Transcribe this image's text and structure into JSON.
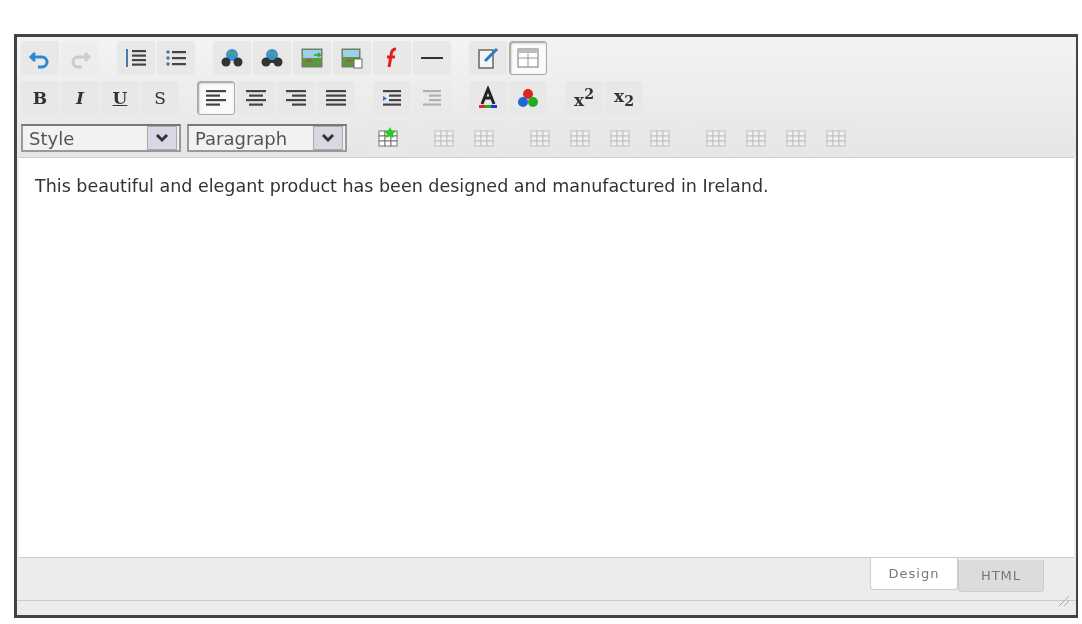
{
  "toolbar_rows": [
    [
      {
        "kind": "undo",
        "disabled": false,
        "active": false
      },
      {
        "kind": "redo",
        "disabled": true,
        "active": false
      },
      {
        "kind": "sep"
      },
      {
        "kind": "numbered-list",
        "disabled": false,
        "active": false
      },
      {
        "kind": "bullet-list",
        "disabled": false,
        "active": false
      },
      {
        "kind": "sep"
      },
      {
        "kind": "link",
        "disabled": false,
        "active": false
      },
      {
        "kind": "unlink",
        "disabled": false,
        "active": false
      },
      {
        "kind": "image",
        "disabled": false,
        "active": false
      },
      {
        "kind": "image-page",
        "disabled": false,
        "active": false
      },
      {
        "kind": "flash",
        "disabled": false,
        "active": false
      },
      {
        "kind": "rule",
        "disabled": false,
        "active": false
      },
      {
        "kind": "sep"
      },
      {
        "kind": "document-pen",
        "disabled": false,
        "active": false
      },
      {
        "kind": "table-grid",
        "disabled": false,
        "active": true
      }
    ],
    [
      {
        "kind": "bold",
        "glyph": "B",
        "disabled": false,
        "active": false
      },
      {
        "kind": "italic",
        "glyph": "I",
        "disabled": false,
        "active": false
      },
      {
        "kind": "underline",
        "glyph": "U",
        "disabled": false,
        "active": false
      },
      {
        "kind": "strike",
        "glyph": "S",
        "disabled": false,
        "active": false
      },
      {
        "kind": "sep"
      },
      {
        "kind": "align-left",
        "disabled": false,
        "active": true
      },
      {
        "kind": "align-center",
        "disabled": false,
        "active": false
      },
      {
        "kind": "align-right",
        "disabled": false,
        "active": false
      },
      {
        "kind": "justify",
        "disabled": false,
        "active": false
      },
      {
        "kind": "sep"
      },
      {
        "kind": "indent",
        "disabled": false,
        "active": false
      },
      {
        "kind": "outdent",
        "disabled": true,
        "active": false
      },
      {
        "kind": "sep"
      },
      {
        "kind": "text-color",
        "disabled": false,
        "active": false
      },
      {
        "kind": "back-color",
        "disabled": false,
        "active": false
      },
      {
        "kind": "sep"
      },
      {
        "kind": "superscript",
        "glyph": "x$^{2}$",
        "disabled": false,
        "active": false
      },
      {
        "kind": "subscript",
        "glyph": "x$_{2}$",
        "disabled": false,
        "active": false
      }
    ],
    [
      {
        "kind": "select",
        "value": "Style"
      },
      {
        "kind": "select",
        "value": "Paragraph"
      },
      {
        "kind": "sep"
      },
      {
        "kind": "insert-table",
        "disabled": false,
        "active": false
      },
      {
        "kind": "sep"
      },
      {
        "kind": "table-cell",
        "disabled": true,
        "active": false
      },
      {
        "kind": "table-cell",
        "disabled": true,
        "active": false
      },
      {
        "kind": "sep"
      },
      {
        "kind": "table-cell",
        "disabled": true,
        "active": false
      },
      {
        "kind": "table-cell",
        "disabled": true,
        "active": false
      },
      {
        "kind": "table-cell",
        "disabled": true,
        "active": false
      },
      {
        "kind": "table-cell",
        "disabled": true,
        "active": false
      },
      {
        "kind": "sep"
      },
      {
        "kind": "table-cell",
        "disabled": true,
        "active": false
      },
      {
        "kind": "table-cell",
        "disabled": true,
        "active": false
      },
      {
        "kind": "table-cell",
        "disabled": true,
        "active": false
      },
      {
        "kind": "table-cell",
        "disabled": true,
        "active": false
      }
    ]
  ],
  "content": "This beautiful and elegant product has been designed and manufactured in Ireland.",
  "mode_tabs": [
    {
      "label": "Design",
      "selected": true
    },
    {
      "label": "HTML",
      "selected": false
    }
  ]
}
